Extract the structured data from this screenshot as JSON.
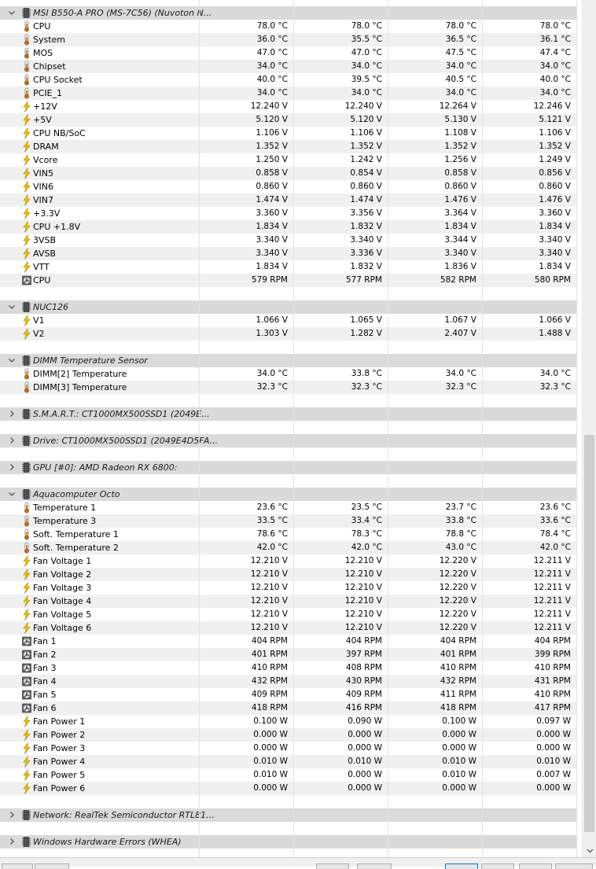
{
  "groups": [
    {
      "name": "MSI B550-A PRO (MS-7C56) (Nuvoton N...",
      "expanded": true,
      "rows": [
        {
          "type": "temp",
          "label": "CPU",
          "values": [
            "78.0 °C",
            "78.0 °C",
            "78.0 °C",
            "78.0 °C"
          ]
        },
        {
          "type": "temp",
          "label": "System",
          "values": [
            "36.0 °C",
            "35.5 °C",
            "36.5 °C",
            "36.1 °C"
          ]
        },
        {
          "type": "temp",
          "label": "MOS",
          "values": [
            "47.0 °C",
            "47.0 °C",
            "47.5 °C",
            "47.4 °C"
          ]
        },
        {
          "type": "temp",
          "label": "Chipset",
          "values": [
            "34.0 °C",
            "34.0 °C",
            "34.0 °C",
            "34.0 °C"
          ]
        },
        {
          "type": "temp",
          "label": "CPU Socket",
          "values": [
            "40.0 °C",
            "39.5 °C",
            "40.5 °C",
            "40.0 °C"
          ]
        },
        {
          "type": "temp",
          "label": "PCIE_1",
          "values": [
            "34.0 °C",
            "34.0 °C",
            "34.0 °C",
            "34.0 °C"
          ]
        },
        {
          "type": "volt",
          "label": "+12V",
          "values": [
            "12.240 V",
            "12.240 V",
            "12.264 V",
            "12.246 V"
          ]
        },
        {
          "type": "volt",
          "label": "+5V",
          "values": [
            "5.120 V",
            "5.120 V",
            "5.130 V",
            "5.121 V"
          ]
        },
        {
          "type": "volt",
          "label": "CPU NB/SoC",
          "values": [
            "1.106 V",
            "1.106 V",
            "1.108 V",
            "1.106 V"
          ]
        },
        {
          "type": "volt",
          "label": "DRAM",
          "values": [
            "1.352 V",
            "1.352 V",
            "1.352 V",
            "1.352 V"
          ]
        },
        {
          "type": "volt",
          "label": "Vcore",
          "values": [
            "1.250 V",
            "1.242 V",
            "1.256 V",
            "1.249 V"
          ]
        },
        {
          "type": "volt",
          "label": "VIN5",
          "values": [
            "0.858 V",
            "0.854 V",
            "0.858 V",
            "0.856 V"
          ]
        },
        {
          "type": "volt",
          "label": "VIN6",
          "values": [
            "0.860 V",
            "0.860 V",
            "0.860 V",
            "0.860 V"
          ]
        },
        {
          "type": "volt",
          "label": "VIN7",
          "values": [
            "1.474 V",
            "1.474 V",
            "1.476 V",
            "1.476 V"
          ]
        },
        {
          "type": "volt",
          "label": "+3.3V",
          "values": [
            "3.360 V",
            "3.356 V",
            "3.364 V",
            "3.360 V"
          ]
        },
        {
          "type": "volt",
          "label": "CPU +1.8V",
          "values": [
            "1.834 V",
            "1.832 V",
            "1.834 V",
            "1.834 V"
          ]
        },
        {
          "type": "volt",
          "label": "3VSB",
          "values": [
            "3.340 V",
            "3.340 V",
            "3.344 V",
            "3.340 V"
          ]
        },
        {
          "type": "volt",
          "label": "AVSB",
          "values": [
            "3.340 V",
            "3.336 V",
            "3.340 V",
            "3.340 V"
          ]
        },
        {
          "type": "volt",
          "label": "VTT",
          "values": [
            "1.834 V",
            "1.832 V",
            "1.836 V",
            "1.834 V"
          ]
        },
        {
          "type": "fan",
          "label": "CPU",
          "values": [
            "579 RPM",
            "577 RPM",
            "582 RPM",
            "580 RPM"
          ]
        }
      ]
    },
    {
      "name": "NUC126",
      "expanded": true,
      "rows": [
        {
          "type": "volt",
          "label": "V1",
          "values": [
            "1.066 V",
            "1.065 V",
            "1.067 V",
            "1.066 V"
          ]
        },
        {
          "type": "volt",
          "label": "V2",
          "values": [
            "1.303 V",
            "1.282 V",
            "2.407 V",
            "1.488 V"
          ]
        }
      ]
    },
    {
      "name": "DIMM Temperature Sensor",
      "expanded": true,
      "rows": [
        {
          "type": "temp",
          "label": "DIMM[2] Temperature",
          "values": [
            "34.0 °C",
            "33.8 °C",
            "34.0 °C",
            "34.0 °C"
          ]
        },
        {
          "type": "temp",
          "label": "DIMM[3] Temperature",
          "values": [
            "32.3 °C",
            "32.3 °C",
            "32.3 °C",
            "32.3 °C"
          ]
        }
      ]
    },
    {
      "name": "S.M.A.R.T.: CT1000MX500SSD1 (2049E...",
      "expanded": false,
      "rows": []
    },
    {
      "name": "Drive: CT1000MX500SSD1 (2049E4D5FA...",
      "expanded": false,
      "rows": []
    },
    {
      "name": "GPU [#0]: AMD Radeon RX 6800:",
      "expanded": false,
      "rows": []
    },
    {
      "name": "Aquacomputer Octo",
      "expanded": true,
      "rows": [
        {
          "type": "temp",
          "label": "Temperature 1",
          "values": [
            "23.6 °C",
            "23.5 °C",
            "23.7 °C",
            "23.6 °C"
          ]
        },
        {
          "type": "temp",
          "label": "Temperature 3",
          "values": [
            "33.5 °C",
            "33.4 °C",
            "33.8 °C",
            "33.6 °C"
          ]
        },
        {
          "type": "temp",
          "label": "Soft. Temperature 1",
          "values": [
            "78.6 °C",
            "78.3 °C",
            "78.8 °C",
            "78.4 °C"
          ]
        },
        {
          "type": "temp",
          "label": "Soft. Temperature 2",
          "values": [
            "42.0 °C",
            "42.0 °C",
            "43.0 °C",
            "42.0 °C"
          ]
        },
        {
          "type": "volt",
          "label": "Fan Voltage 1",
          "values": [
            "12.210 V",
            "12.210 V",
            "12.220 V",
            "12.211 V"
          ]
        },
        {
          "type": "volt",
          "label": "Fan Voltage 2",
          "values": [
            "12.210 V",
            "12.210 V",
            "12.220 V",
            "12.211 V"
          ]
        },
        {
          "type": "volt",
          "label": "Fan Voltage 3",
          "values": [
            "12.210 V",
            "12.210 V",
            "12.220 V",
            "12.211 V"
          ]
        },
        {
          "type": "volt",
          "label": "Fan Voltage 4",
          "values": [
            "12.210 V",
            "12.210 V",
            "12.220 V",
            "12.211 V"
          ]
        },
        {
          "type": "volt",
          "label": "Fan Voltage 5",
          "values": [
            "12.210 V",
            "12.210 V",
            "12.220 V",
            "12.211 V"
          ]
        },
        {
          "type": "volt",
          "label": "Fan Voltage 6",
          "values": [
            "12.210 V",
            "12.210 V",
            "12.220 V",
            "12.211 V"
          ]
        },
        {
          "type": "fan",
          "label": "Fan 1",
          "values": [
            "404 RPM",
            "404 RPM",
            "404 RPM",
            "404 RPM"
          ]
        },
        {
          "type": "fan",
          "label": "Fan 2",
          "values": [
            "401 RPM",
            "397 RPM",
            "401 RPM",
            "399 RPM"
          ]
        },
        {
          "type": "fan",
          "label": "Fan 3",
          "values": [
            "410 RPM",
            "408 RPM",
            "410 RPM",
            "410 RPM"
          ]
        },
        {
          "type": "fan",
          "label": "Fan 4",
          "values": [
            "432 RPM",
            "430 RPM",
            "432 RPM",
            "431 RPM"
          ]
        },
        {
          "type": "fan",
          "label": "Fan 5",
          "values": [
            "409 RPM",
            "409 RPM",
            "411 RPM",
            "410 RPM"
          ]
        },
        {
          "type": "fan",
          "label": "Fan 6",
          "values": [
            "418 RPM",
            "416 RPM",
            "418 RPM",
            "417 RPM"
          ]
        },
        {
          "type": "volt",
          "label": "Fan Power 1",
          "values": [
            "0.100 W",
            "0.090 W",
            "0.100 W",
            "0.097 W"
          ]
        },
        {
          "type": "volt",
          "label": "Fan Power 2",
          "values": [
            "0.000 W",
            "0.000 W",
            "0.000 W",
            "0.000 W"
          ]
        },
        {
          "type": "volt",
          "label": "Fan Power 3",
          "values": [
            "0.000 W",
            "0.000 W",
            "0.000 W",
            "0.000 W"
          ]
        },
        {
          "type": "volt",
          "label": "Fan Power 4",
          "values": [
            "0.010 W",
            "0.010 W",
            "0.010 W",
            "0.010 W"
          ]
        },
        {
          "type": "volt",
          "label": "Fan Power 5",
          "values": [
            "0.010 W",
            "0.000 W",
            "0.010 W",
            "0.007 W"
          ]
        },
        {
          "type": "volt",
          "label": "Fan Power 6",
          "values": [
            "0.000 W",
            "0.000 W",
            "0.000 W",
            "0.000 W"
          ]
        }
      ]
    },
    {
      "name": "Network: RealTek Semiconductor RTL81...",
      "expanded": false,
      "rows": []
    },
    {
      "name": "Windows Hardware Errors (WHEA)",
      "expanded": false,
      "rows": []
    }
  ],
  "icons": {
    "temp": "thermometer-icon",
    "volt": "lightning-icon",
    "fan": "fan-icon",
    "group": "chip-icon"
  },
  "colors": {
    "group_row_bg": "#dadada",
    "alt_row_bg": "#f0f0f0",
    "voltage_icon": "#f2c300",
    "thermometer_icon": "#c07020",
    "scroll_thumb": "#cdcdcd",
    "active_tab_border": "#0078d7"
  },
  "scrollbar": {
    "thumb_start_fraction": 0.515,
    "thumb_size_fraction": 0.47
  }
}
